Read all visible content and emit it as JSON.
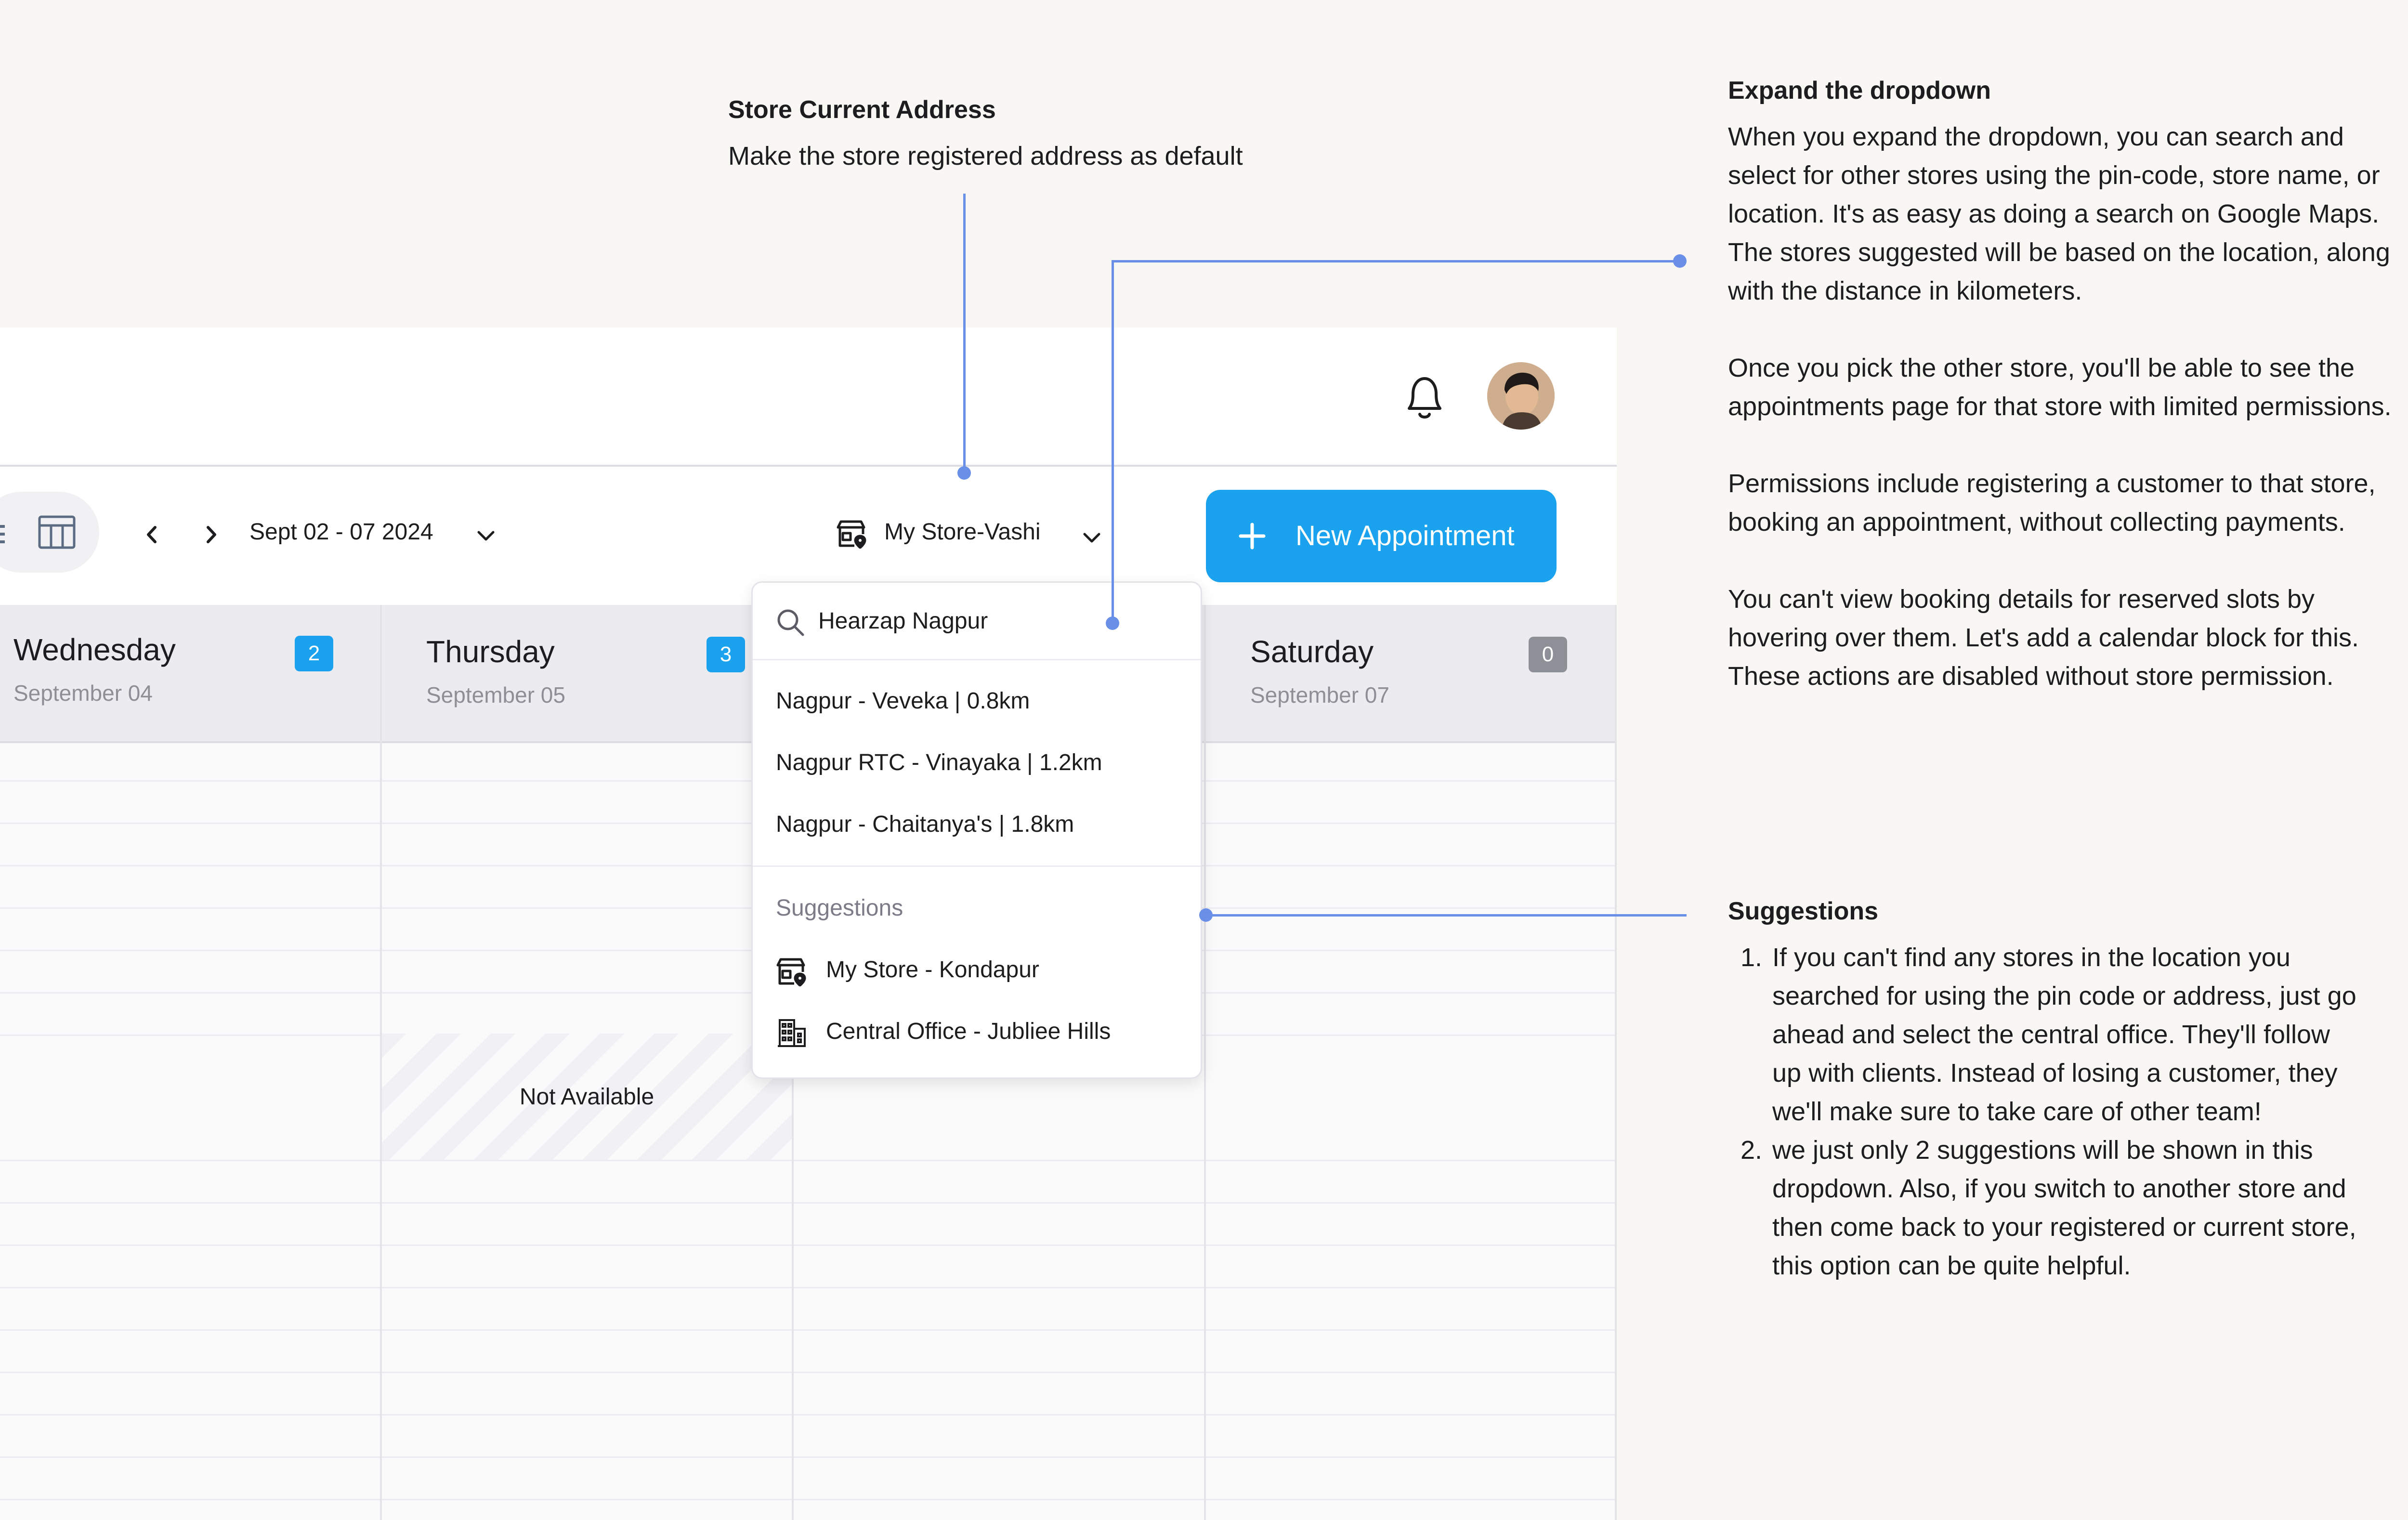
{
  "annotations": {
    "store_address": {
      "title": "Store Current Address",
      "text": "Make the store registered address as default"
    },
    "expand_dropdown": {
      "title": "Expand the dropdown",
      "paragraphs": [
        "When you expand the dropdown, you can search and select for other stores using the pin-code, store name, or location. It's as easy as doing a search on Google Maps. The stores suggested will be based on the location, along with the distance in kilometers.",
        "Once you pick the other store, you'll be able to see the appointments page for that store with limited permissions.",
        "Permissions include registering a customer to that store, booking an appointment, without collecting payments.",
        "You can't view booking details for reserved slots by hovering over them. Let's add a calendar block for this. These actions are disabled without store permission."
      ]
    },
    "suggestions": {
      "title": "Suggestions",
      "items": [
        "If you can't find any stores in the location you searched for using the pin code or address, just go ahead and select the central office. They'll follow up with clients. Instead of losing a customer, they we'll make sure to take care of other team!",
        "we just only 2 suggestions will be shown in this dropdown. Also, if you switch to another store and then come back to your registered or current store, this option can be quite helpful."
      ]
    }
  },
  "toolbar": {
    "date_range": "Sept 02 - 07 2024",
    "store_selector": "My Store-Vashi",
    "new_appointment": "New Appointment"
  },
  "calendar": {
    "days": [
      {
        "name": "Wednesday",
        "date": "September 04",
        "count": "2"
      },
      {
        "name": "Thursday",
        "date": "September 05",
        "count": "3"
      },
      {
        "name": "Saturday",
        "date": "September 07",
        "count": "0"
      }
    ],
    "not_available": "Not Available"
  },
  "dropdown": {
    "search_value": "Hearzap Nagpur",
    "results": [
      "Nagpur - Veveka | 0.8km",
      "Nagpur RTC - Vinayaka | 1.2km",
      "Nagpur - Chaitanya's | 1.8km"
    ],
    "suggestions_label": "Suggestions",
    "suggestions": [
      {
        "label": "My Store - Kondapur",
        "icon": "store-icon"
      },
      {
        "label": "Central Office - Jubliee Hills",
        "icon": "building-icon"
      }
    ]
  },
  "colors": {
    "accent": "#1aa2ee",
    "connector": "#6a8fe6",
    "badge_inactive": "#8e9098",
    "background": "#f8f7f4"
  }
}
